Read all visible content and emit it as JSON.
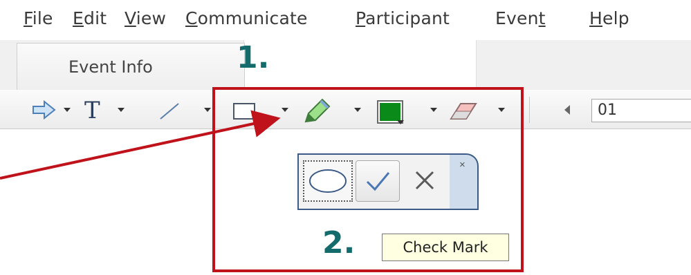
{
  "menu": {
    "items": [
      {
        "label": "File"
      },
      {
        "label": "Edit"
      },
      {
        "label": "View"
      },
      {
        "label": "Communicate"
      },
      {
        "label": "Participant"
      },
      {
        "label": "Event"
      },
      {
        "label": "Help"
      }
    ]
  },
  "tabs": {
    "active_label": "Event Info"
  },
  "toolbar": {
    "page_value": "01"
  },
  "popup": {
    "close_label": "×"
  },
  "tooltip": {
    "text": "Check Mark"
  },
  "annotations": {
    "step1": "1.",
    "step2": "2."
  },
  "colors": {
    "accent_red": "#c0121b",
    "step_teal": "#136b6b",
    "popup_border": "#3b5a85",
    "color_swatch": "#0a8a18"
  },
  "icons": [
    "arrow-pointer-icon",
    "text-tool-icon",
    "line-tool-icon",
    "rectangle-tool-icon",
    "highlighter-icon",
    "color-swatch-icon",
    "eraser-icon",
    "prev-page-icon",
    "ellipse-icon",
    "check-icon",
    "close-x-icon"
  ]
}
